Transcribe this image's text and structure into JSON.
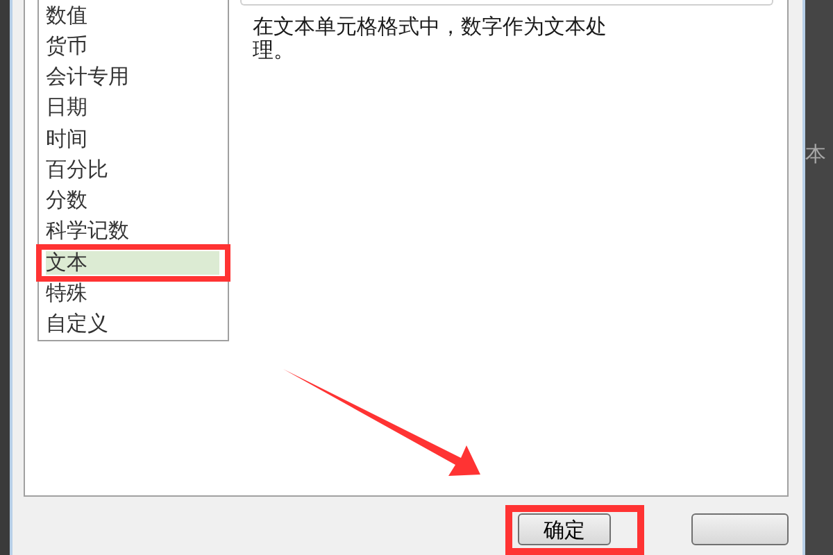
{
  "categories": [
    {
      "label": "数值",
      "selected": false
    },
    {
      "label": "货币",
      "selected": false
    },
    {
      "label": "会计专用",
      "selected": false
    },
    {
      "label": "日期",
      "selected": false
    },
    {
      "label": "时间",
      "selected": false
    },
    {
      "label": "百分比",
      "selected": false
    },
    {
      "label": "分数",
      "selected": false
    },
    {
      "label": "科学记数",
      "selected": false
    },
    {
      "label": "文本",
      "selected": true
    },
    {
      "label": "特殊",
      "selected": false
    },
    {
      "label": "自定义",
      "selected": false
    }
  ],
  "description": "在文本单元格格式中，数字作为文本处理。",
  "ok_button": "确定",
  "background_text": "本"
}
